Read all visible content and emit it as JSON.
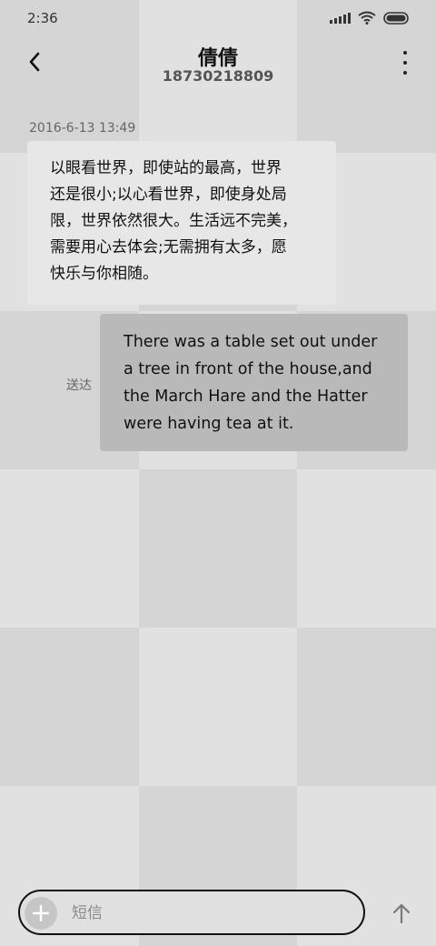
{
  "status_bar": {
    "time": "2:36"
  },
  "header": {
    "contact_name": "倩倩",
    "contact_number": "18730218809"
  },
  "conversation": {
    "timestamp": "2016-6-13 13:49",
    "messages": [
      {
        "direction": "incoming",
        "lines": [
          "以眼看世界，即使站的最高，世界",
          "还是很小;以心看世界，即使身处局",
          "限，世界依然很大。生活远不完美，",
          "需要用心去体会;无需拥有太多，愿",
          "快乐与你相随。"
        ]
      },
      {
        "direction": "outgoing",
        "status": "送达",
        "lines": [
          "There was a table set out under",
          "a tree in front of the house,and",
          "the March Hare and the Hatter",
          "were having tea at it."
        ]
      }
    ]
  },
  "composer": {
    "placeholder": "短信",
    "value": ""
  },
  "icons": {
    "back": "chevron-left-icon",
    "more": "more-vertical-icon",
    "add": "plus-icon",
    "send": "arrow-up-icon",
    "signal": "signal-icon",
    "wifi": "wifi-icon",
    "battery": "battery-icon"
  },
  "colors": {
    "incoming_bubble": "#e7e7e7",
    "outgoing_bubble": "#b9b9b9",
    "text": "#111111",
    "muted_text": "#666666"
  }
}
